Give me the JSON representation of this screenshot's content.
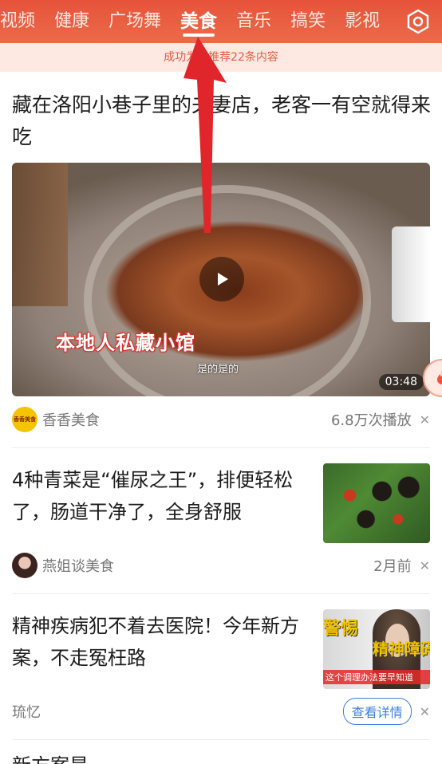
{
  "tabs": [
    {
      "label": "视频"
    },
    {
      "label": "健康"
    },
    {
      "label": "广场舞"
    },
    {
      "label": "美食",
      "active": true
    },
    {
      "label": "音乐"
    },
    {
      "label": "搞笑"
    },
    {
      "label": "影视"
    }
  ],
  "settings_icon": "gear-hexagon-icon",
  "notice": {
    "text": "成功为您推荐22条内容"
  },
  "feed": [
    {
      "title": "藏在洛阳小巷子里的夫妻店，老客一有空就得来吃",
      "video": {
        "overlay_text": "本地人私藏小馆",
        "subtitle": "是的是的",
        "duration": "03:48"
      },
      "author": "香香美食",
      "avatar_text": "香香美食",
      "plays": "6.8万次播放"
    },
    {
      "title": "4种青菜是“催尿之王”，排便轻松了，肠道干净了，全身舒服",
      "author": "燕姐谈美食",
      "time": "2月前"
    },
    {
      "title": "精神疾病犯不着去医院！今年新方案，不走冤枉路",
      "thumb_text_a": "警惕",
      "thumb_text_b": "精神障碍",
      "thumb_caption": "这个调理办法要早知道",
      "author": "琉忆",
      "detail_label": "查看详情"
    }
  ],
  "next_title": "新方案是……"
}
